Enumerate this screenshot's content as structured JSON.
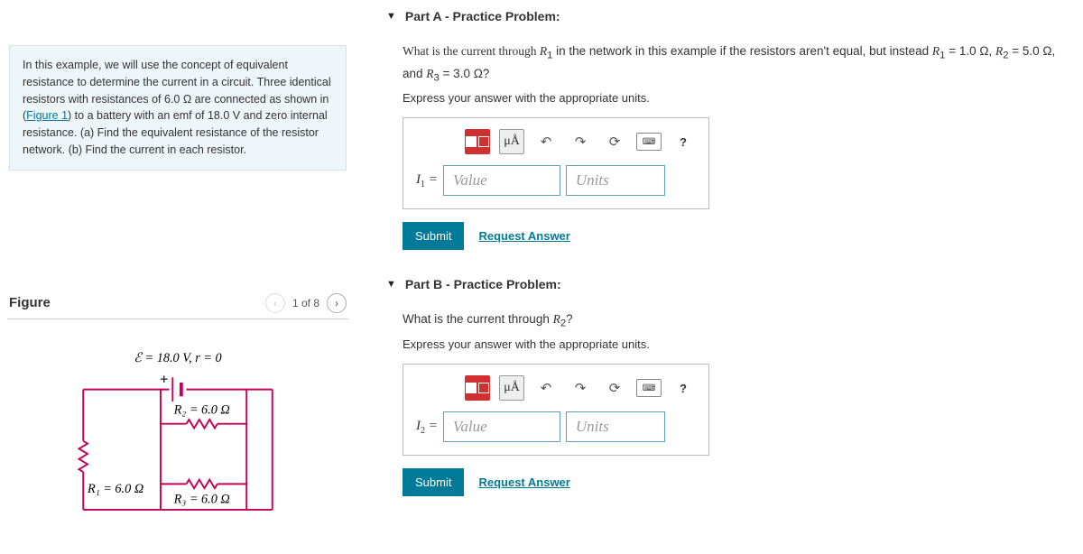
{
  "intro": {
    "text_before_link": "In this example, we will use the concept of equivalent resistance to determine the current in a circuit. Three identical resistors with resistances of 6.0 Ω are connected as shown in (",
    "link_text": "Figure 1",
    "text_after_link": ") to a battery with an emf of 18.0 V and zero internal resistance. (a) Find the equivalent resistance of the resistor network. (b) Find the current in each resistor."
  },
  "figure": {
    "title": "Figure",
    "pager": "1 of 8",
    "emf_label": "ℰ = 18.0 V, r = 0",
    "r1_label": "R₁ = 6.0 Ω",
    "r2_label": "R₂ = 6.0 Ω",
    "r3_label": "R₃ = 6.0 Ω"
  },
  "partA": {
    "header": "Part A - Practice Problem:",
    "prompt": "What is the current through R₁ in the network in this example if the resistors aren't equal, but instead R₁ = 1.0 Ω, R₂ = 5.0 Ω, and R₃ = 3.0 Ω?",
    "sub": "Express your answer with the appropriate units.",
    "lhs": "I₁ =",
    "value_ph": "Value",
    "units_ph": "Units",
    "submit": "Submit",
    "request": "Request Answer",
    "tool_units": "μÅ",
    "tool_help": "?"
  },
  "partB": {
    "header": "Part B - Practice Problem:",
    "prompt": "What is the current through R₂?",
    "sub": "Express your answer with the appropriate units.",
    "lhs": "I₂ =",
    "value_ph": "Value",
    "units_ph": "Units",
    "submit": "Submit",
    "request": "Request Answer",
    "tool_units": "μÅ",
    "tool_help": "?"
  }
}
